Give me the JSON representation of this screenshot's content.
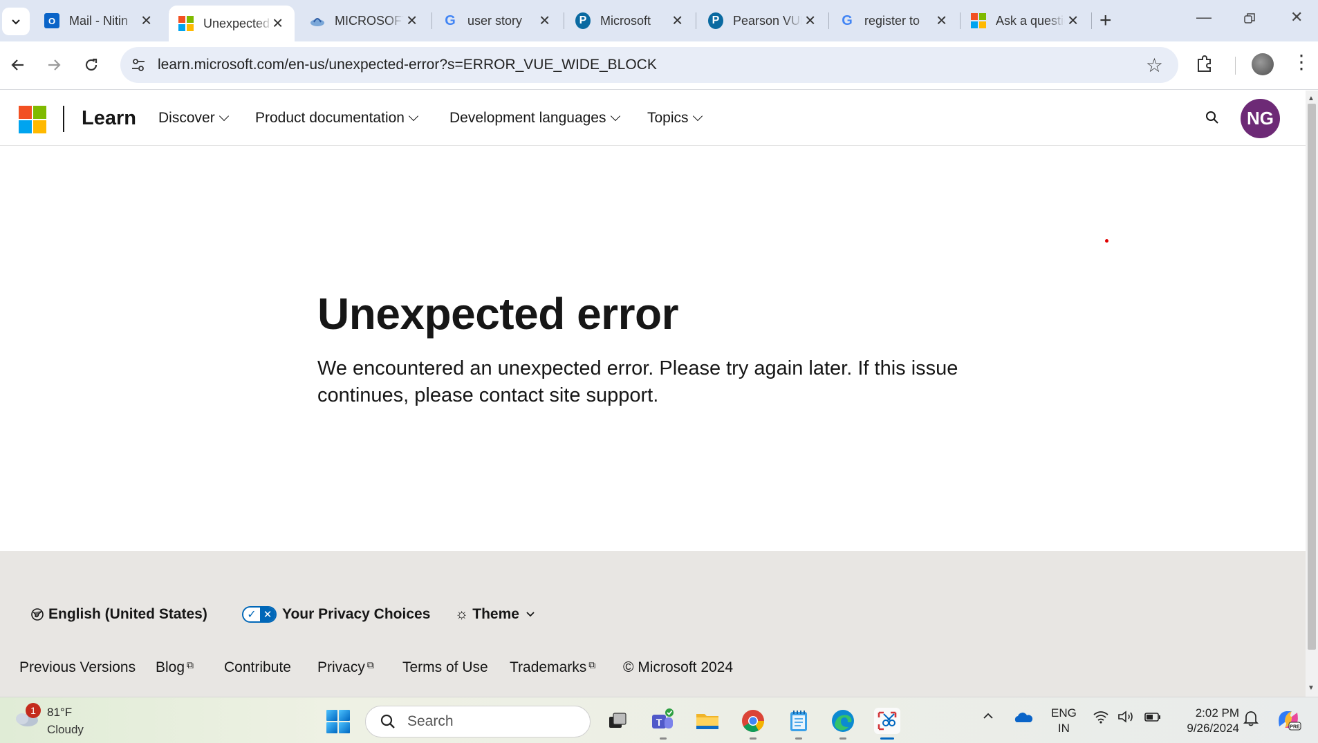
{
  "browser": {
    "tabs": [
      {
        "title": "Mail - Nitin",
        "icon": "outlook-icon"
      },
      {
        "title": "Unexpected error",
        "icon": "microsoft-icon",
        "active": true
      },
      {
        "title": "MICROSOFT",
        "icon": "certiport-icon"
      },
      {
        "title": "user story",
        "icon": "google-icon"
      },
      {
        "title": "Microsoft",
        "icon": "pearson-icon"
      },
      {
        "title": "Pearson VUE",
        "icon": "pearson-icon"
      },
      {
        "title": "register to",
        "icon": "google-icon"
      },
      {
        "title": "Ask a question",
        "icon": "microsoft-icon"
      }
    ],
    "url": "learn.microsoft.com/en-us/unexpected-error?s=ERROR_VUE_WIDE_BLOCK"
  },
  "header": {
    "brand": "Learn",
    "nav": [
      "Discover",
      "Product documentation",
      "Development languages",
      "Topics"
    ],
    "avatar_initials": "NG",
    "avatar_color": "#6d2a76"
  },
  "main": {
    "title": "Unexpected error",
    "message": "We encountered an unexpected error. Please try again later. If this issue continues, please contact site support."
  },
  "footer": {
    "locale": "English (United States)",
    "privacy": "Your Privacy Choices",
    "theme": "Theme",
    "links": [
      "Previous Versions",
      "Blog",
      "Contribute",
      "Privacy",
      "Terms of Use",
      "Trademarks"
    ],
    "copyright": "© Microsoft 2024"
  },
  "taskbar": {
    "weather": {
      "temp": "81°F",
      "condition": "Cloudy",
      "badge": "1"
    },
    "search_placeholder": "Search",
    "language": {
      "line1": "ENG",
      "line2": "IN"
    },
    "clock": {
      "time": "2:02 PM",
      "date": "9/26/2024"
    }
  },
  "colors": {
    "accent": "#0067b8",
    "footer_bg": "#e8e6e3",
    "tabstrip_bg": "#dfe6f3"
  }
}
